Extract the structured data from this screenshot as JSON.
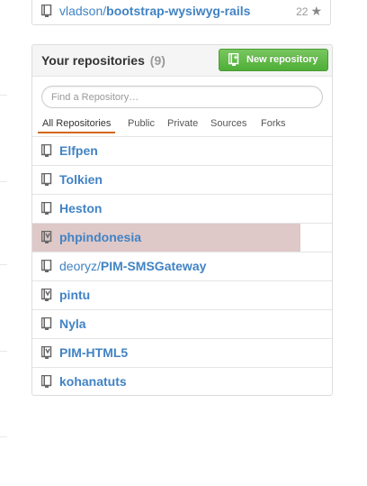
{
  "starred_repo": {
    "owner": "vladson/",
    "name": "bootstrap-wysiwyg-rails",
    "star_count": "22",
    "icon": "repo-icon"
  },
  "panel": {
    "title": "Your repositories",
    "count": "(9)",
    "new_repo_label": "New repository",
    "new_repo_icon": "new-repo-icon"
  },
  "search": {
    "placeholder": "Find a Repository…",
    "value": ""
  },
  "filter_tabs": [
    {
      "label": "All Repositories",
      "selected": true
    },
    {
      "label": "Public",
      "selected": false
    },
    {
      "label": "Private",
      "selected": false
    },
    {
      "label": "Sources",
      "selected": false
    },
    {
      "label": "Forks",
      "selected": false
    }
  ],
  "repositories": [
    {
      "owner": "",
      "name": "Elfpen",
      "type": "public",
      "highlighted": false
    },
    {
      "owner": "",
      "name": "Tolkien",
      "type": "public",
      "highlighted": false
    },
    {
      "owner": "",
      "name": "Heston",
      "type": "public",
      "highlighted": false
    },
    {
      "owner": "",
      "name": "phpindonesia",
      "type": "mirror",
      "highlighted": true
    },
    {
      "owner": "deoryz/",
      "name": "PIM-SMSGateway",
      "type": "public",
      "highlighted": false
    },
    {
      "owner": "",
      "name": "pintu",
      "type": "mirror",
      "highlighted": false
    },
    {
      "owner": "",
      "name": "Nyla",
      "type": "public",
      "highlighted": false
    },
    {
      "owner": "",
      "name": "PIM-HTML5",
      "type": "mirror",
      "highlighted": false
    },
    {
      "owner": "",
      "name": "kohanatuts",
      "type": "public",
      "highlighted": false
    }
  ],
  "colors": {
    "link": "#4183c4",
    "button_green": "#5cb543",
    "highlight_row": "#dfc8c8",
    "tab_underline": "#d26911"
  }
}
